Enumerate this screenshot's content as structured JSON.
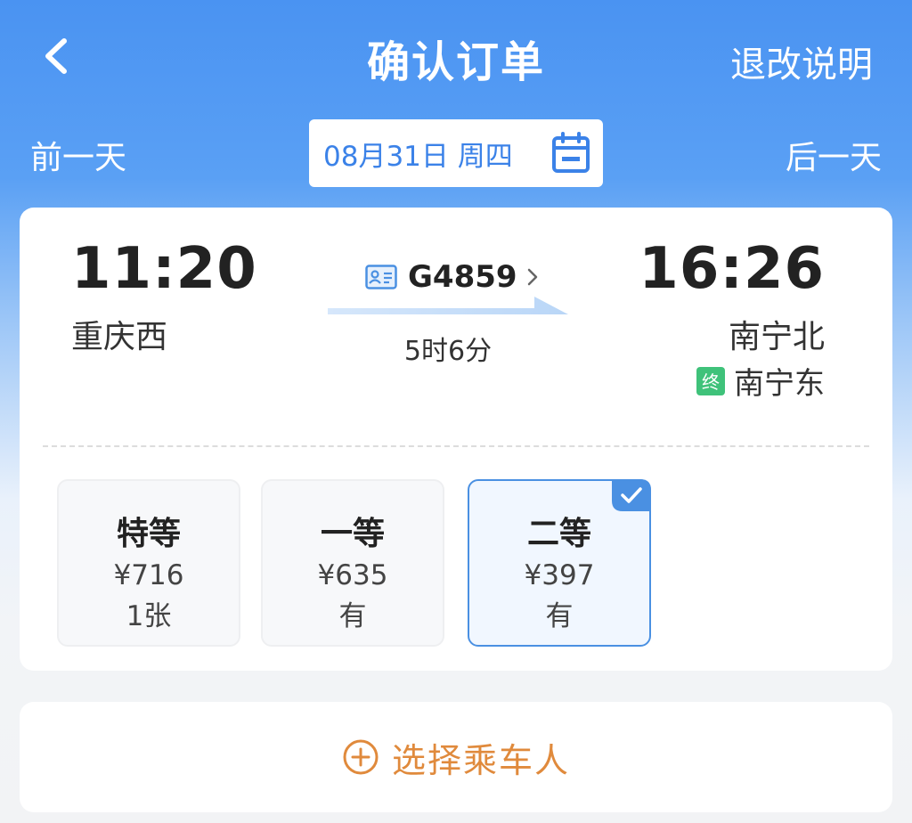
{
  "header": {
    "title": "确认订单",
    "right_link": "退改说明"
  },
  "date_nav": {
    "prev": "前一天",
    "date": "08月31日 周四",
    "next": "后一天"
  },
  "train": {
    "departure_time": "11:20",
    "departure_station": "重庆西",
    "train_number": "G4859",
    "duration": "5时6分",
    "arrival_time": "16:26",
    "arrival_station": "南宁北",
    "terminal_badge": "终",
    "terminal_station": "南宁东"
  },
  "seats": [
    {
      "name": "特等",
      "price": "¥716",
      "availability": "1张",
      "selected": false
    },
    {
      "name": "一等",
      "price": "¥635",
      "availability": "有",
      "selected": false
    },
    {
      "name": "二等",
      "price": "¥397",
      "availability": "有",
      "selected": true
    }
  ],
  "passenger": {
    "label": "选择乘车人"
  },
  "colors": {
    "primary": "#4a93f2",
    "accent_orange": "#e08a3c",
    "terminal_green": "#3fc27a",
    "selected_border": "#4a90e2"
  }
}
